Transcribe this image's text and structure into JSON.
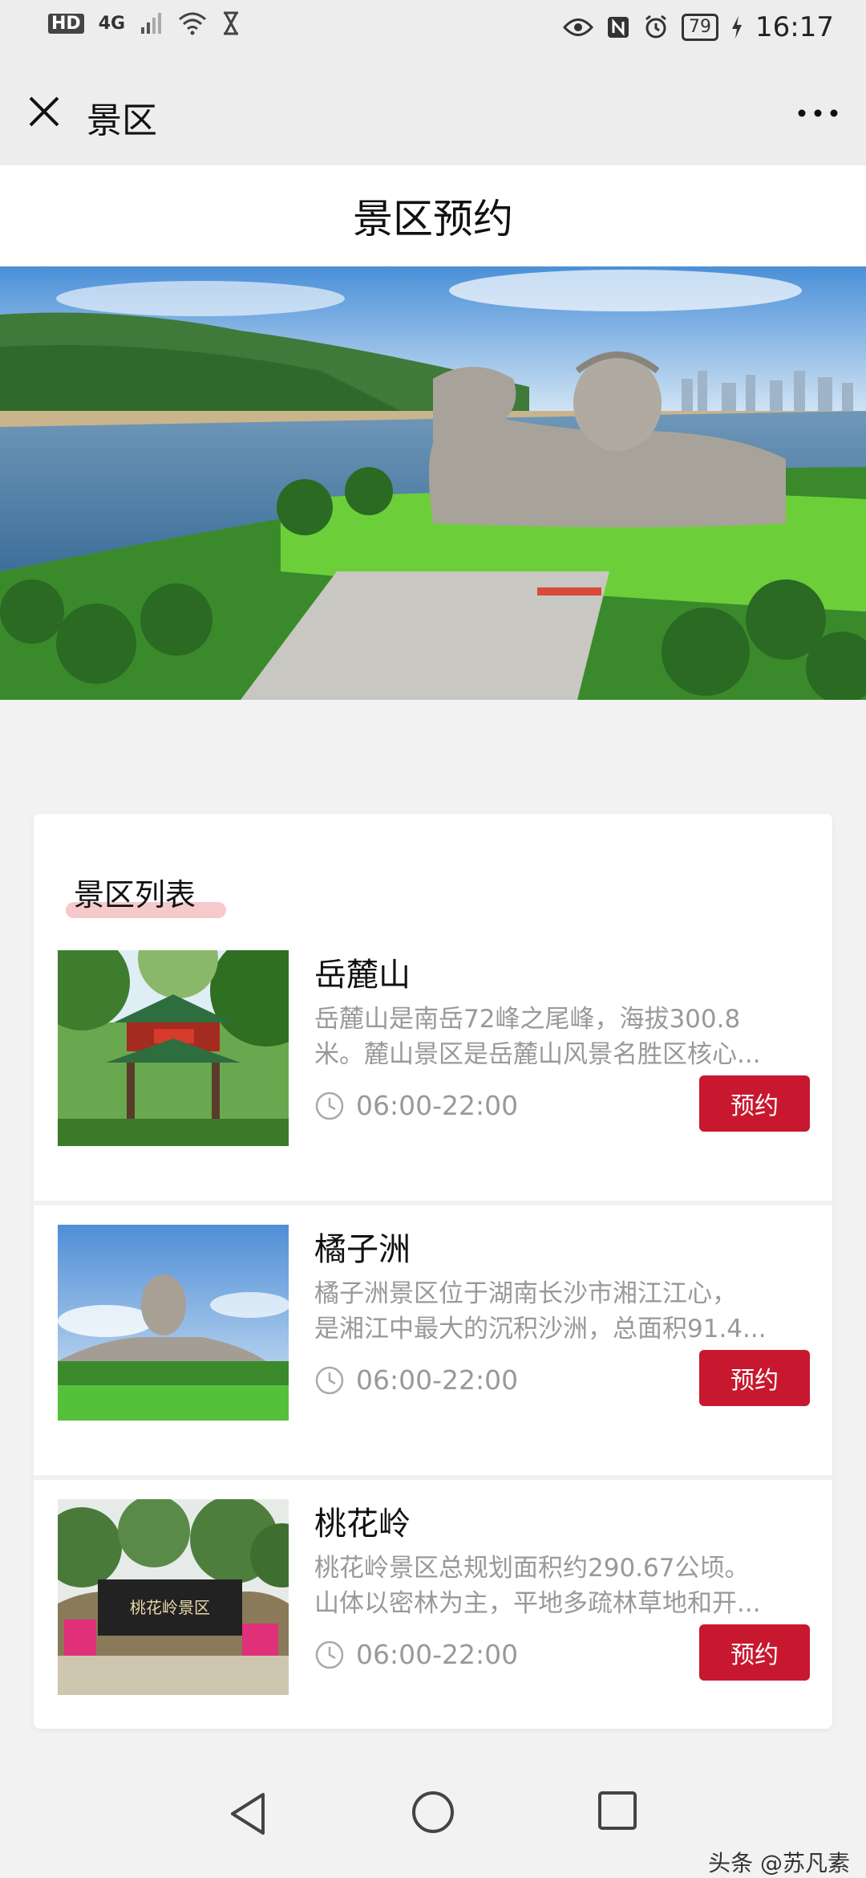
{
  "status_bar": {
    "left_label": "HD",
    "network": "4G",
    "battery": "79",
    "time": "16:17"
  },
  "nav": {
    "title": "景区",
    "close_icon": "close-icon",
    "more_icon": "more-icon"
  },
  "page": {
    "title": "景区预约"
  },
  "list": {
    "heading": "景区列表",
    "items": [
      {
        "name": "岳麓山",
        "desc_line1": "岳麓山是南岳72峰之尾峰，海拔300.8",
        "desc_line2": "米。麓山景区是岳麓山风景名胜区核心...",
        "hours": "06:00-22:00",
        "button": "预约"
      },
      {
        "name": "橘子洲",
        "desc_line1": "橘子洲景区位于湖南长沙市湘江江心，",
        "desc_line2": "是湘江中最大的沉积沙洲，总面积91.4...",
        "hours": "06:00-22:00",
        "button": "预约"
      },
      {
        "name": "桃花岭",
        "desc_line1": "桃花岭景区总规划面积约290.67公顷。",
        "desc_line2": "山体以密林为主，平地多疏林草地和开...",
        "hours": "06:00-22:00",
        "button": "预约"
      }
    ],
    "thumb3_sign": "桃花岭景区"
  },
  "watermark": "头条 @苏凡素",
  "colors": {
    "accent": "#c8182f",
    "nav_bg": "#ededed",
    "highlight": "#f6c9cb"
  }
}
